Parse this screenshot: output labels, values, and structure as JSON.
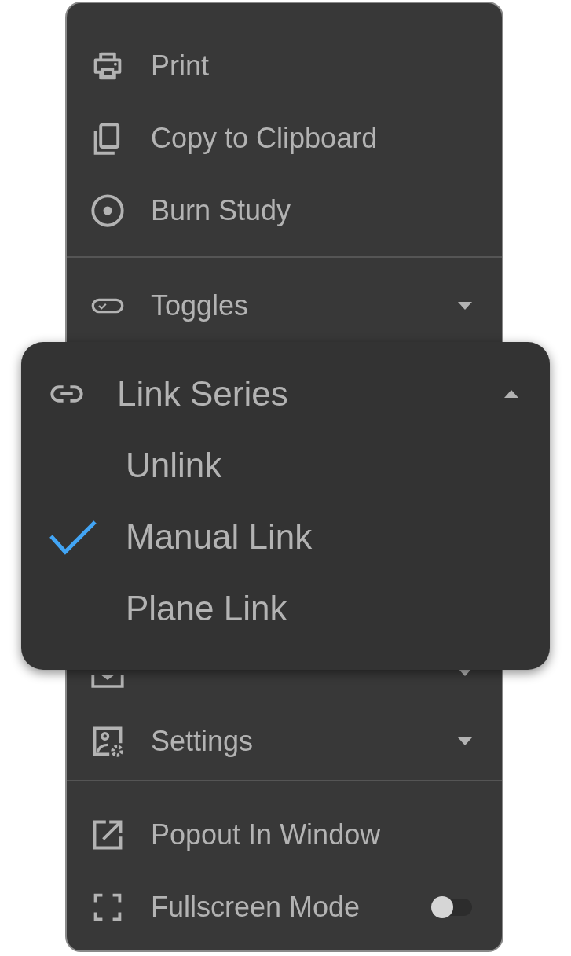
{
  "menu": {
    "sections": [
      {
        "items": [
          {
            "kind": "action",
            "label": "Print"
          },
          {
            "kind": "action",
            "label": "Copy to Clipboard"
          },
          {
            "kind": "action",
            "label": "Burn Study"
          }
        ]
      },
      {
        "items": [
          {
            "kind": "submenu",
            "label": "Toggles",
            "expanded": false
          },
          {
            "kind": "gap"
          },
          {
            "kind": "submenu",
            "expanded": false
          },
          {
            "kind": "submenu",
            "label": "Settings",
            "expanded": false
          }
        ]
      },
      {
        "items": [
          {
            "kind": "action",
            "label": "Popout In Window"
          },
          {
            "kind": "switch",
            "label": "Fullscreen Mode",
            "on": false
          }
        ]
      }
    ]
  },
  "popup": {
    "title": "Link Series",
    "expanded": true,
    "options": [
      {
        "label": "Unlink",
        "selected": false
      },
      {
        "label": "Manual Link",
        "selected": true
      },
      {
        "label": "Plane Link",
        "selected": false
      }
    ]
  }
}
